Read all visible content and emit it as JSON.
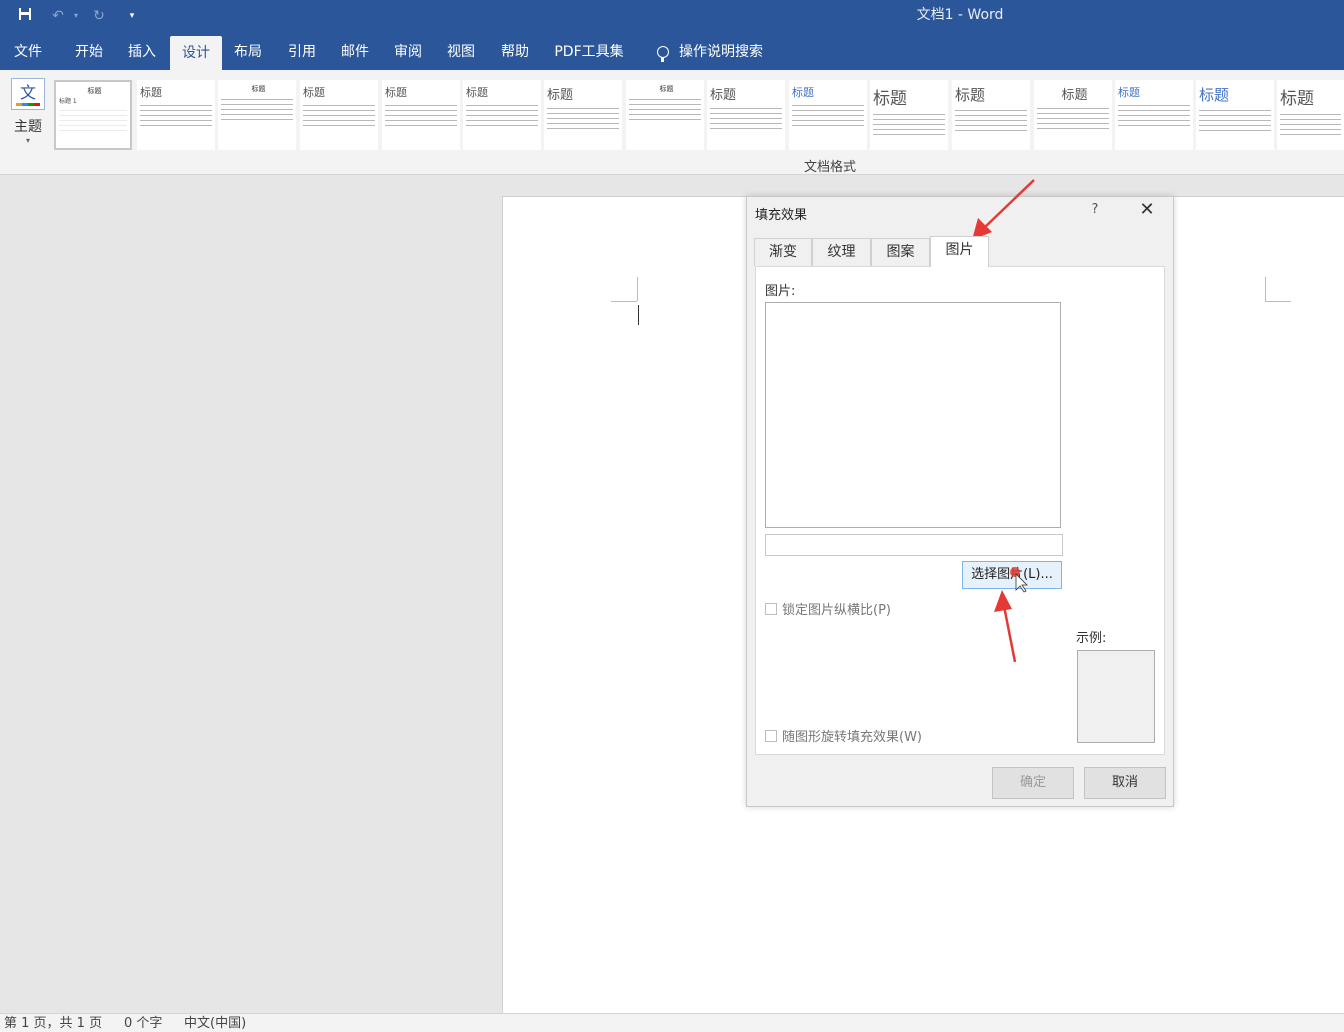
{
  "titlebar": {
    "title": "文档1  -  Word",
    "save_icon": "save-icon",
    "undo_icon": "undo-icon",
    "redo_icon": "redo-icon",
    "customize_icon": "customize-quick-access-icon"
  },
  "tabs": [
    "文件",
    "开始",
    "插入",
    "设计",
    "布局",
    "引用",
    "邮件",
    "审阅",
    "视图",
    "帮助",
    "PDF工具集"
  ],
  "active_tab": "设计",
  "tell_me": "操作说明搜索",
  "ribbon": {
    "theme_label": "主题",
    "theme_icon_char": "文",
    "group_label": "文档格式",
    "style_sample_heading": "标题",
    "style_sample_heading1": "标题 1"
  },
  "dialog": {
    "title": "填充效果",
    "help": "?",
    "close": "✕",
    "tabs": [
      "渐变",
      "纹理",
      "图案",
      "图片"
    ],
    "active_tab": "图片",
    "picture_label": "图片:",
    "select_button": "选择图片(L)...",
    "lock_aspect": "锁定图片纵横比(P)",
    "rotate_with_shape": "随图形旋转填充效果(W)",
    "sample_label": "示例:",
    "ok": "确定",
    "cancel": "取消"
  },
  "statusbar": {
    "page": "第 1 页，共 1 页",
    "words": "0 个字",
    "language": "中文(中国)"
  },
  "colors": {
    "brand": "#2b579a",
    "annotation": "#e53935"
  }
}
